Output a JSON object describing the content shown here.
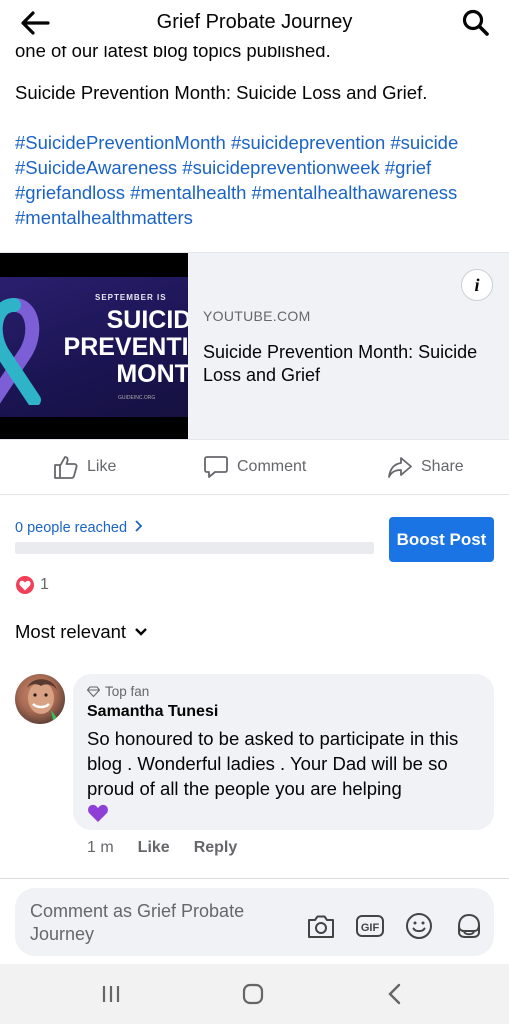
{
  "header": {
    "title": "Grief Probate Journey",
    "back_icon": "arrow-left-icon",
    "search_icon": "search-icon"
  },
  "post": {
    "cut_off_line": "one of our latest blog topics published.",
    "paragraph": "Suicide Prevention Month: Suicide Loss and Grief.",
    "hashtags": "#SuicidePreventionMonth #suicideprevention #suicide #SuicideAwareness #suicidepreventionweek #grief #griefandloss #mentalhealth #mentalhealthawareness #mentalhealthmatters"
  },
  "link_card": {
    "thumb_small": "SEPTEMBER IS",
    "thumb_line1": "SUICIDE",
    "thumb_line2": "PREVENTIO",
    "thumb_line3": "MONTH",
    "thumb_tiny": "GUIDEINC.ORG",
    "domain": "YOUTUBE.COM",
    "headline": "Suicide Prevention Month: Suicide Loss and Grief",
    "info_label": "i"
  },
  "actions": {
    "like": "Like",
    "comment": "Comment",
    "share": "Share"
  },
  "insights": {
    "reached": "0 people reached",
    "boost": "Boost Post"
  },
  "reactions": {
    "count": "1"
  },
  "sort": {
    "label": "Most relevant"
  },
  "comment": {
    "badge": "Top fan",
    "author": "Samantha Tunesi",
    "text": "So honoured to be asked to participate in this blog . Wonderful ladies . Your Dad will be so proud of all the people you are helping",
    "time": "1 m",
    "like": "Like",
    "reply": "Reply"
  },
  "composer": {
    "placeholder": "Comment as Grief Probate Journey"
  },
  "colors": {
    "link_blue": "#1b64c6",
    "boost_blue": "#1b74e4",
    "heart_red": "#f33e58",
    "bubble_gray": "#f0f2f5"
  }
}
